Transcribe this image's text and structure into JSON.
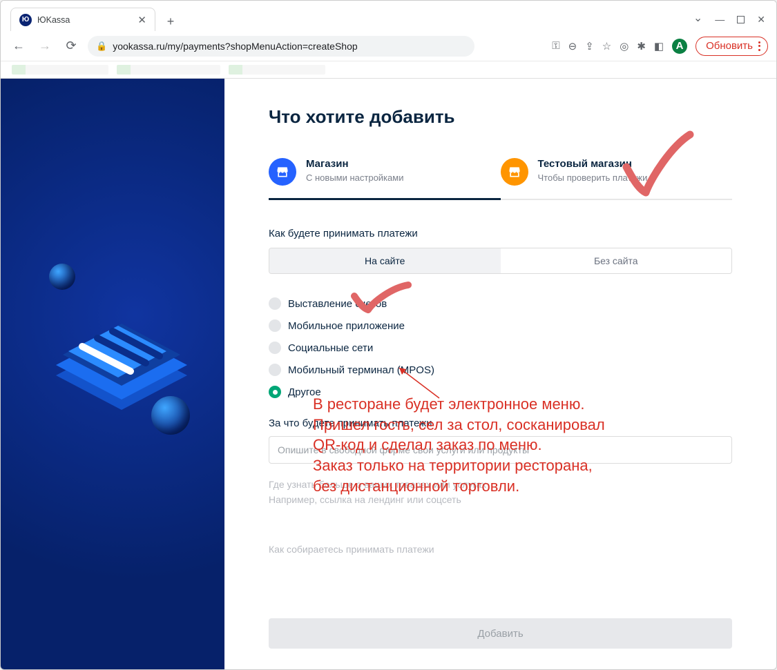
{
  "browser": {
    "tab_title": "ЮKassa",
    "url": "yookassa.ru/my/payments?shopMenuAction=createShop",
    "update_label": "Обновить",
    "avatar_letter": "A"
  },
  "page": {
    "heading": "Что хотите добавить",
    "choices": [
      {
        "title": "Магазин",
        "sub": "С новыми настройками",
        "active": true
      },
      {
        "title": "Тестовый магазин",
        "sub": "Чтобы проверить платежи",
        "active": false
      }
    ],
    "accept_label": "Как будете принимать платежи",
    "seg_options": [
      "На сайте",
      "Без сайта"
    ],
    "seg_active": 0,
    "radios": [
      {
        "label": "Выставление счетов",
        "selected": false
      },
      {
        "label": "Мобильное приложение",
        "selected": false
      },
      {
        "label": "Социальные сети",
        "selected": false
      },
      {
        "label": "Мобильный терминал (MPOS)",
        "selected": false
      },
      {
        "label": "Другое",
        "selected": true
      }
    ],
    "desc_label": "За что будете принимать платежи",
    "desc_placeholder": "Опишите в свободной форме свои услуги или продукты",
    "faded1_a": "Где узнать больше о ваших товарах или услугах",
    "faded1_b": "Например, ссылка на лендинг или соцсеть",
    "faded2": "Как собираетесь принимать платежи",
    "submit": "Добавить"
  },
  "annotation": {
    "text": "В ресторане будет электронное меню.\nПришел гость, сел за стол, сосканировал\nQR-код и сделал заказ по меню.\nЗаказ только на территории ресторана,\nбез дистанционной торговли."
  }
}
